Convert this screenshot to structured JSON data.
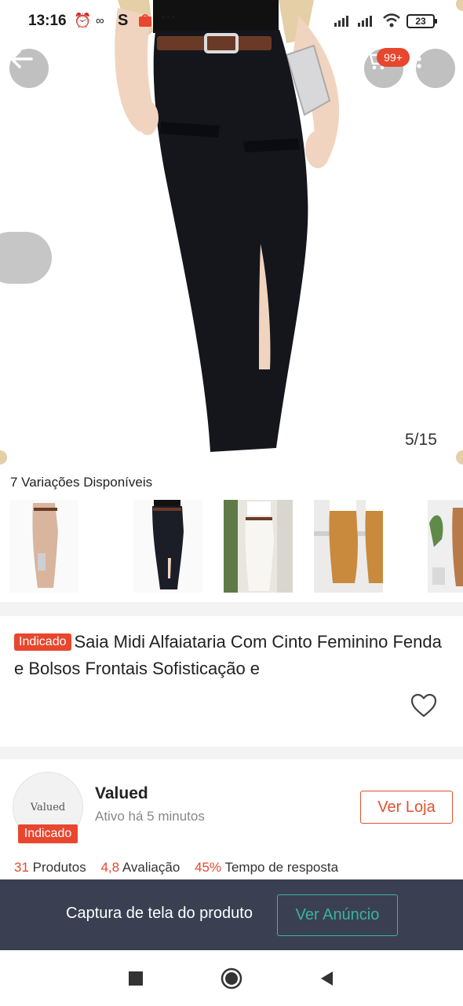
{
  "status_bar": {
    "time": "13:16",
    "battery": "23"
  },
  "top_bar": {
    "cart_badge": "99+"
  },
  "gallery": {
    "counter": "5/15"
  },
  "variations": {
    "title": "7 Variações Disponíveis",
    "items": [
      {
        "color": "#d8b59c"
      },
      {
        "color": "#1b1e26"
      },
      {
        "color": "#f1efea"
      },
      {
        "color": "#c98a3e"
      },
      {
        "color": "#b97a4a"
      }
    ]
  },
  "product": {
    "tag": "Indicado",
    "title": "Saia Midi Alfaiataria Com Cinto Feminino Fenda e Bolsos Frontais Sofisticação e"
  },
  "shop": {
    "logo_text": "Valued",
    "tag": "Indicado",
    "name": "Valued",
    "active": "Ativo há 5 minutos",
    "visit_label": "Ver Loja",
    "stats": [
      {
        "value": "31",
        "label": "Produtos"
      },
      {
        "value": "4,8",
        "label": "Avaliação"
      },
      {
        "value": "45%",
        "label": "Tempo de resposta"
      }
    ]
  },
  "capture_banner": {
    "text": "Captura de tela do produto",
    "button_label": "Ver Anúncio"
  },
  "colors": {
    "accent": "#e8462e",
    "banner_bg": "#3a4052",
    "banner_button": "#3bb39a"
  }
}
